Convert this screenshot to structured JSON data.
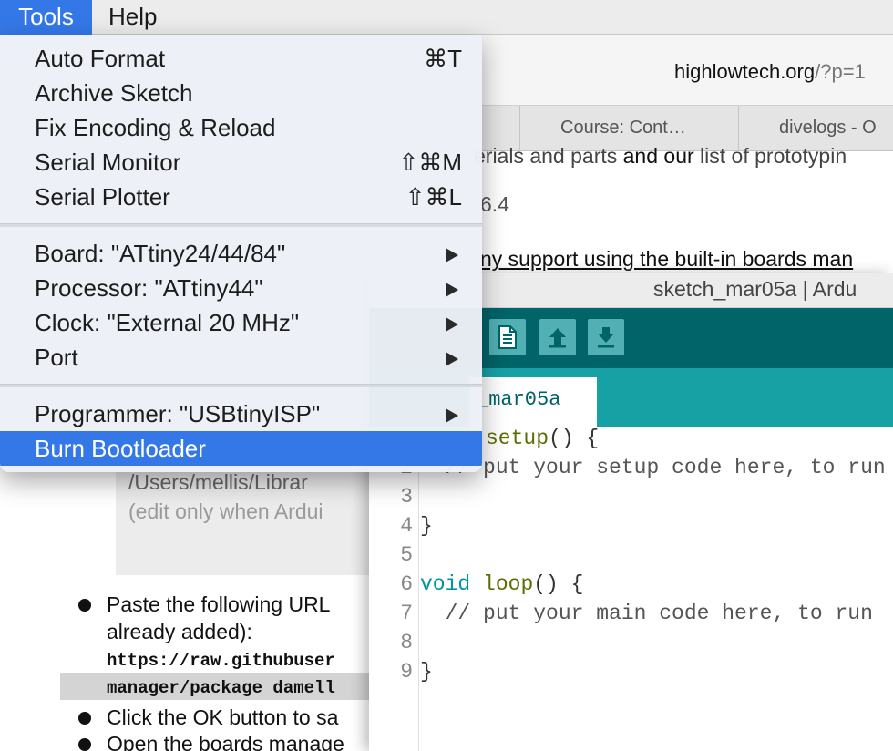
{
  "menubar": {
    "tools": "Tools",
    "help": "Help"
  },
  "browser": {
    "url_host": "highlowtech.org",
    "url_path": "/?p=1",
    "tabs": [
      "Course: Cont…",
      "divelogs - O"
    ],
    "page": {
      "line1_a": "erials and parts",
      "line1_b": " and our ",
      "line1_c": "list of prototypin",
      "version": "6.4",
      "line3": "ny support using the built-in boards man",
      "greybox_line1": "/Users/mellis/Librar",
      "greybox_line2": "(edit only when Ardui",
      "bullet1_line1": "Paste the following URL",
      "bullet1_line2": "already added):",
      "code1": "https://raw.githubuser",
      "code2": "manager/package_damell",
      "bullet2": "Click the OK button to sa",
      "bullet3": "Open the boards manage"
    }
  },
  "arduino": {
    "title": "sketch_mar05a | Ardu",
    "toolbar": {
      "new": "new-icon",
      "open": "open-icon",
      "save": "save-icon"
    },
    "tab_label": "_mar05a",
    "line_numbers": [
      "2",
      "3",
      "4",
      "5",
      "6",
      "7",
      "8",
      "9"
    ],
    "code": {
      "l1_fn": "setup",
      "l1_rest": "() {",
      "l2": "  // put your setup code here, to run",
      "l4": "}",
      "l6_kw": "void",
      "l6_sp": " ",
      "l6_fn": "loop",
      "l6_rest": "() {",
      "l7": "  // put your main code here, to run",
      "l9": "}"
    }
  },
  "tools_menu": {
    "items": [
      {
        "label": "Auto Format",
        "shortcut": "⌘T"
      },
      {
        "label": "Archive Sketch",
        "shortcut": ""
      },
      {
        "label": "Fix Encoding & Reload",
        "shortcut": ""
      },
      {
        "label": "Serial Monitor",
        "shortcut": "⇧⌘M"
      },
      {
        "label": "Serial Plotter",
        "shortcut": "⇧⌘L"
      },
      {
        "label": "Board: \"ATtiny24/44/84\"",
        "shortcut": ""
      },
      {
        "label": "Processor: \"ATtiny44\"",
        "shortcut": ""
      },
      {
        "label": "Clock: \"External 20 MHz\"",
        "shortcut": ""
      },
      {
        "label": "Port",
        "shortcut": ""
      },
      {
        "label": "Programmer: \"USBtinyISP\"",
        "shortcut": ""
      },
      {
        "label": "Burn Bootloader",
        "shortcut": ""
      }
    ],
    "highlighted": "Burn Bootloader"
  },
  "colors": {
    "accent": "#3478e8",
    "arduino_dark": "#006468",
    "arduino_teal": "#17a1a5"
  }
}
